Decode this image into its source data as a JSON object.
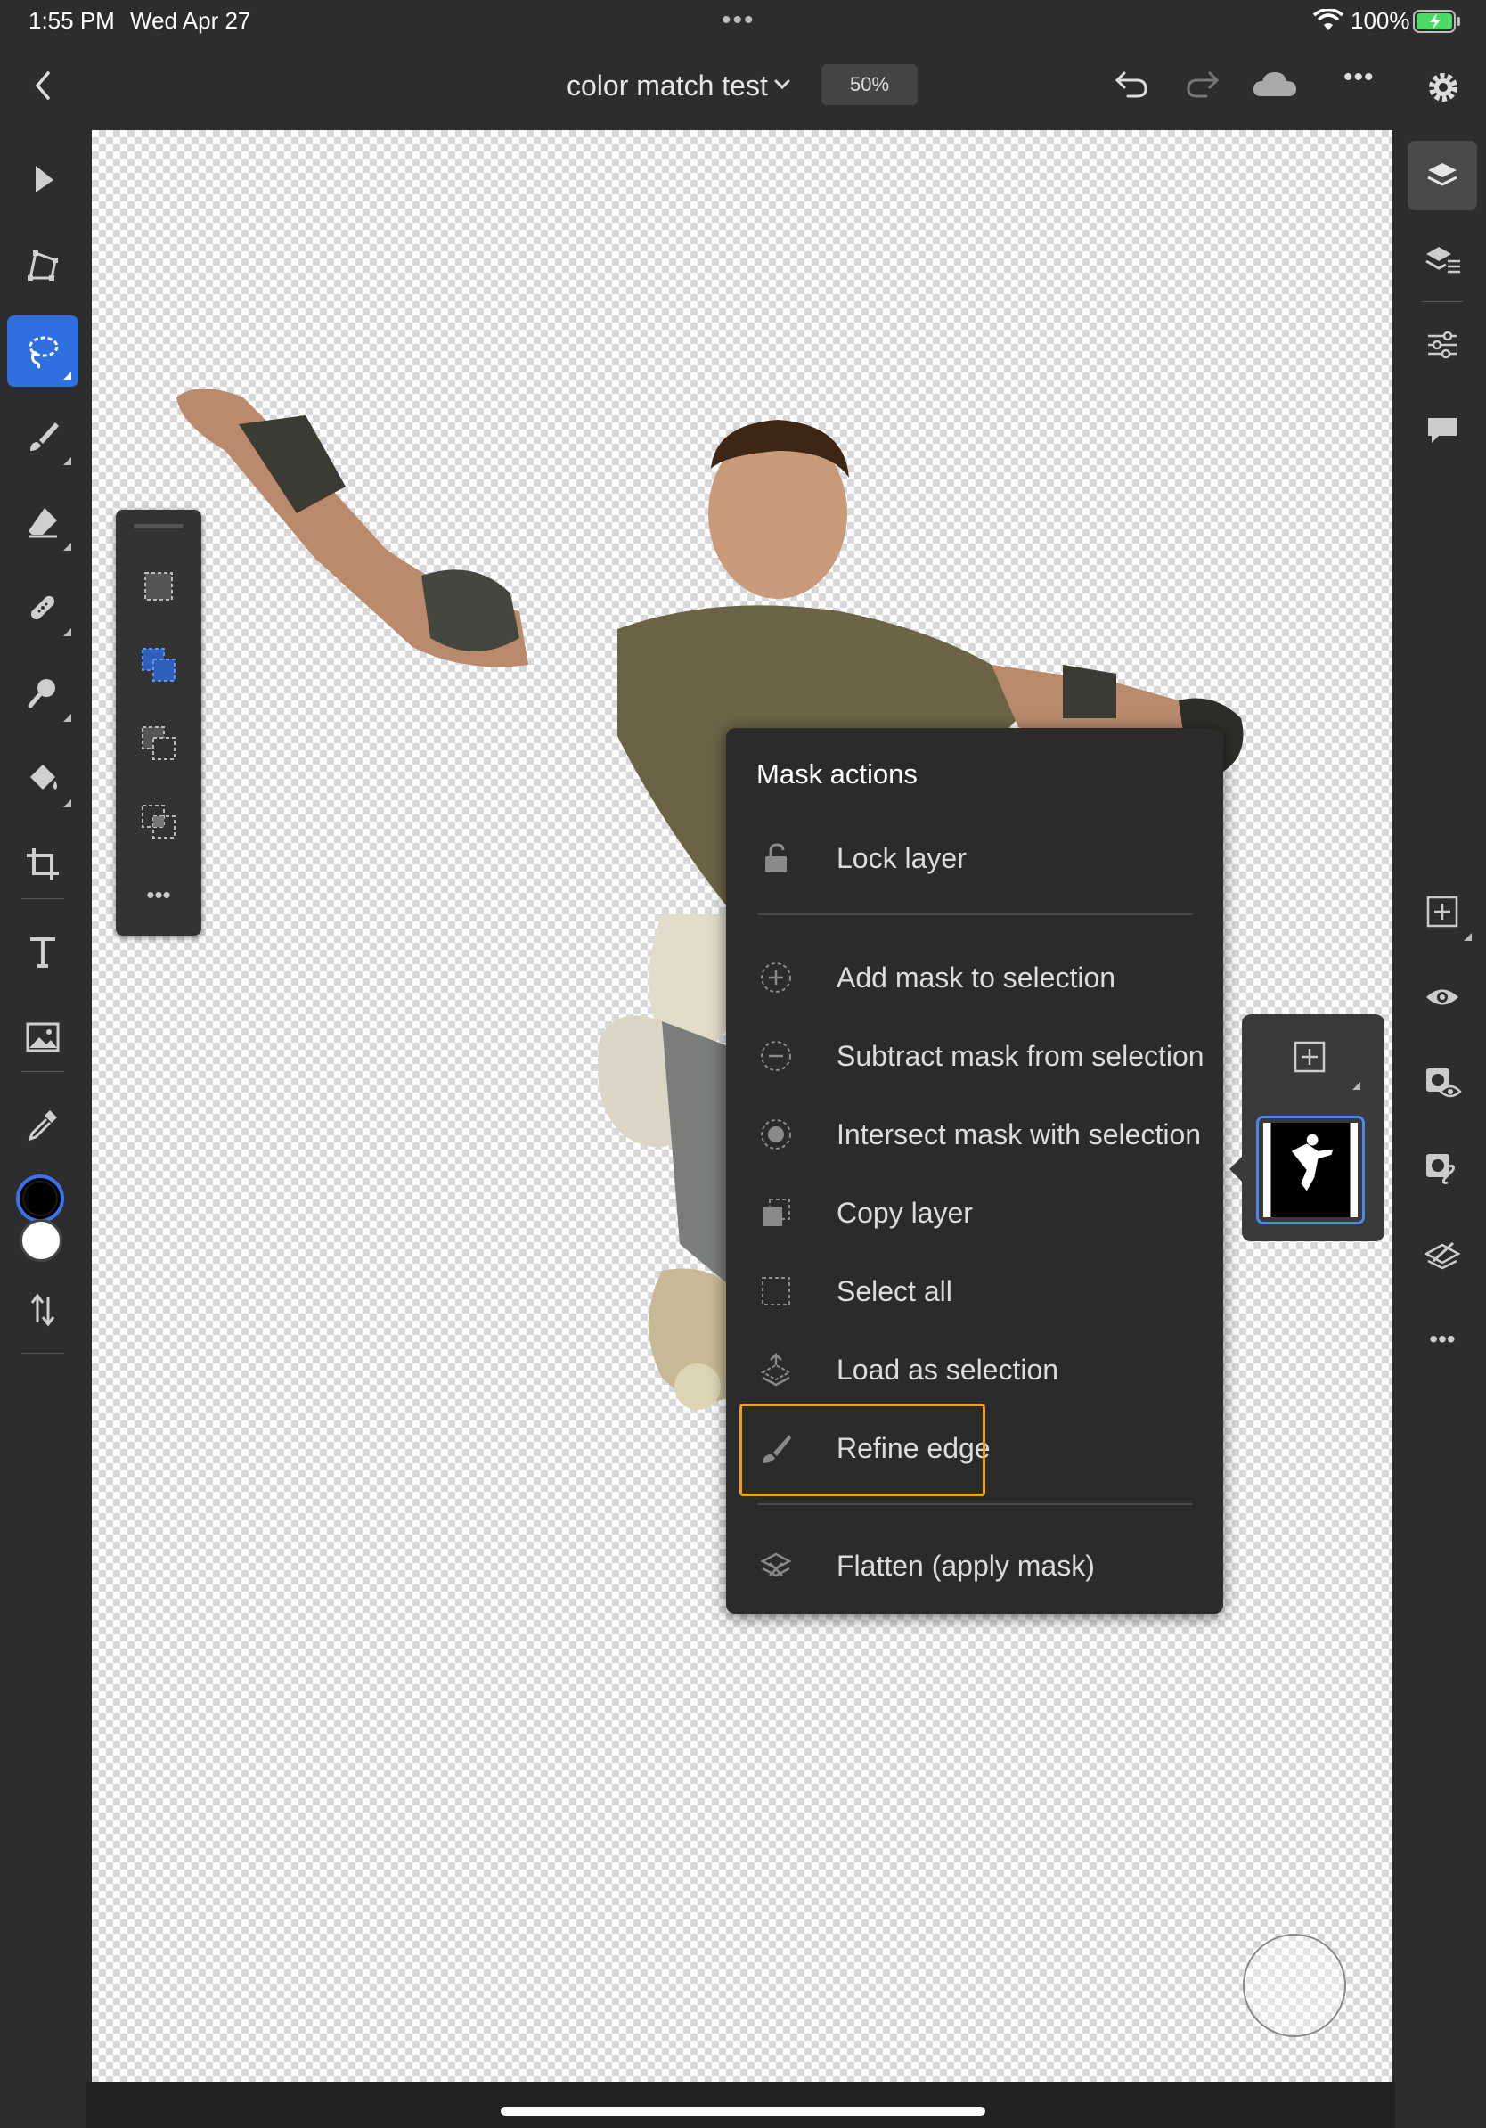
{
  "status_bar": {
    "time": "1:55 PM",
    "date": "Wed Apr 27",
    "battery_pct": "100%"
  },
  "top_bar": {
    "document_title": "color match test",
    "zoom": "50%"
  },
  "left_toolbar": {
    "tools": [
      "select-tool",
      "transform-tool",
      "lasso-tool",
      "brush-tool",
      "eraser-tool",
      "healing-tool",
      "clone-tool",
      "fill-tool",
      "crop-tool",
      "type-tool",
      "place-image-tool",
      "eyedropper-tool",
      "swap-colors-tool"
    ],
    "active_tool": "lasso-tool",
    "colors": {
      "foreground": "#000000",
      "background": "#ffffff"
    }
  },
  "selection_panel": {
    "items": [
      "new-selection",
      "add-to-selection",
      "subtract-from-selection",
      "intersect-selection",
      "more"
    ]
  },
  "mask_menu": {
    "title": "Mask actions",
    "lock": {
      "label": "Lock layer",
      "icon": "lock-icon"
    },
    "items": [
      {
        "label": "Add mask to selection",
        "icon": "add-circle-icon"
      },
      {
        "label": "Subtract mask from selection",
        "icon": "subtract-circle-icon"
      },
      {
        "label": "Intersect mask with selection",
        "icon": "intersect-circle-icon"
      },
      {
        "label": "Copy layer",
        "icon": "copy-layer-icon"
      },
      {
        "label": "Select all",
        "icon": "select-all-icon"
      },
      {
        "label": "Load as selection",
        "icon": "load-selection-icon"
      },
      {
        "label": "Refine edge",
        "icon": "refine-edge-brush-icon"
      }
    ],
    "flatten": {
      "label": "Flatten (apply mask)",
      "icon": "flatten-icon"
    },
    "highlighted_item": "Refine edge",
    "highlight_color": "#f0a020"
  },
  "right_rail": {
    "buttons": [
      "layers-icon",
      "layer-properties-icon",
      "adjustments-icon",
      "comments-icon",
      "add-layer-icon",
      "visibility-icon",
      "mask-visibility-icon",
      "link-icon",
      "clip-icon",
      "more-icon"
    ],
    "active": "layers-icon"
  },
  "colors": {
    "accent_blue": "#2f6fe0",
    "ui_dark": "#2d2d2d"
  }
}
